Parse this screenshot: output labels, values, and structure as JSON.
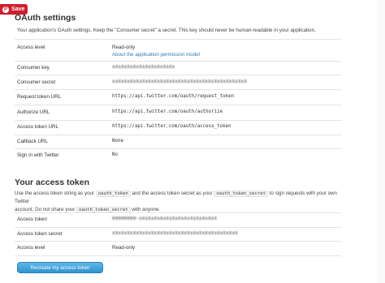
{
  "save_badge": {
    "label": "Save",
    "icon": "pinterest-icon"
  },
  "oauth": {
    "title": "OAuth settings",
    "intro": "Your application's OAuth settings. Keep the \"Consumer secret\" a secret. This key should never be human-readable in your application.",
    "rows": [
      {
        "label": "Access level",
        "value": "Read-only",
        "link": "About the application permission model"
      },
      {
        "label": "Consumer key",
        "value": "xXxXxXxXxXxXxXxXxXxXx"
      },
      {
        "label": "Consumer secret",
        "value": "xxXxXxXxXxXxXxXxXxXxXxXxXxXxXxXxXxXxXxXxXxXxX"
      },
      {
        "label": "Request token URL",
        "value": "https://api.twitter.com/oauth/request_token"
      },
      {
        "label": "Authorize URL",
        "value": "https://api.twitter.com/oauth/authorize"
      },
      {
        "label": "Access token URL",
        "value": "https://api.twitter.com/oauth/access_token"
      },
      {
        "label": "Callback URL",
        "value": "None"
      },
      {
        "label": "Sign in with Twitter",
        "value": "No"
      }
    ]
  },
  "access": {
    "title": "Your access token",
    "para_1": "Use the access token string as your",
    "code_1": "oauth_token",
    "para_2": "and the access token secret as your",
    "code_2": "oauth_token_secret",
    "para_3": "to sign requests with your own Twitter",
    "para_4": "account. Do not share your",
    "code_3": "oauth_token_secret",
    "para_5": "with anyone.",
    "rows": [
      {
        "label": "Access token",
        "value": "00000000-xXxXxXxXxXxXxXxXxXxXxXxXxX"
      },
      {
        "label": "Access token secret",
        "value": "xXxXxXxXxXxXxXxXxXxXxXxXxXxXxXxXxXxXxXxXxX"
      },
      {
        "label": "Access level",
        "value": "Read-only"
      }
    ],
    "button": "Recreate my access token"
  }
}
